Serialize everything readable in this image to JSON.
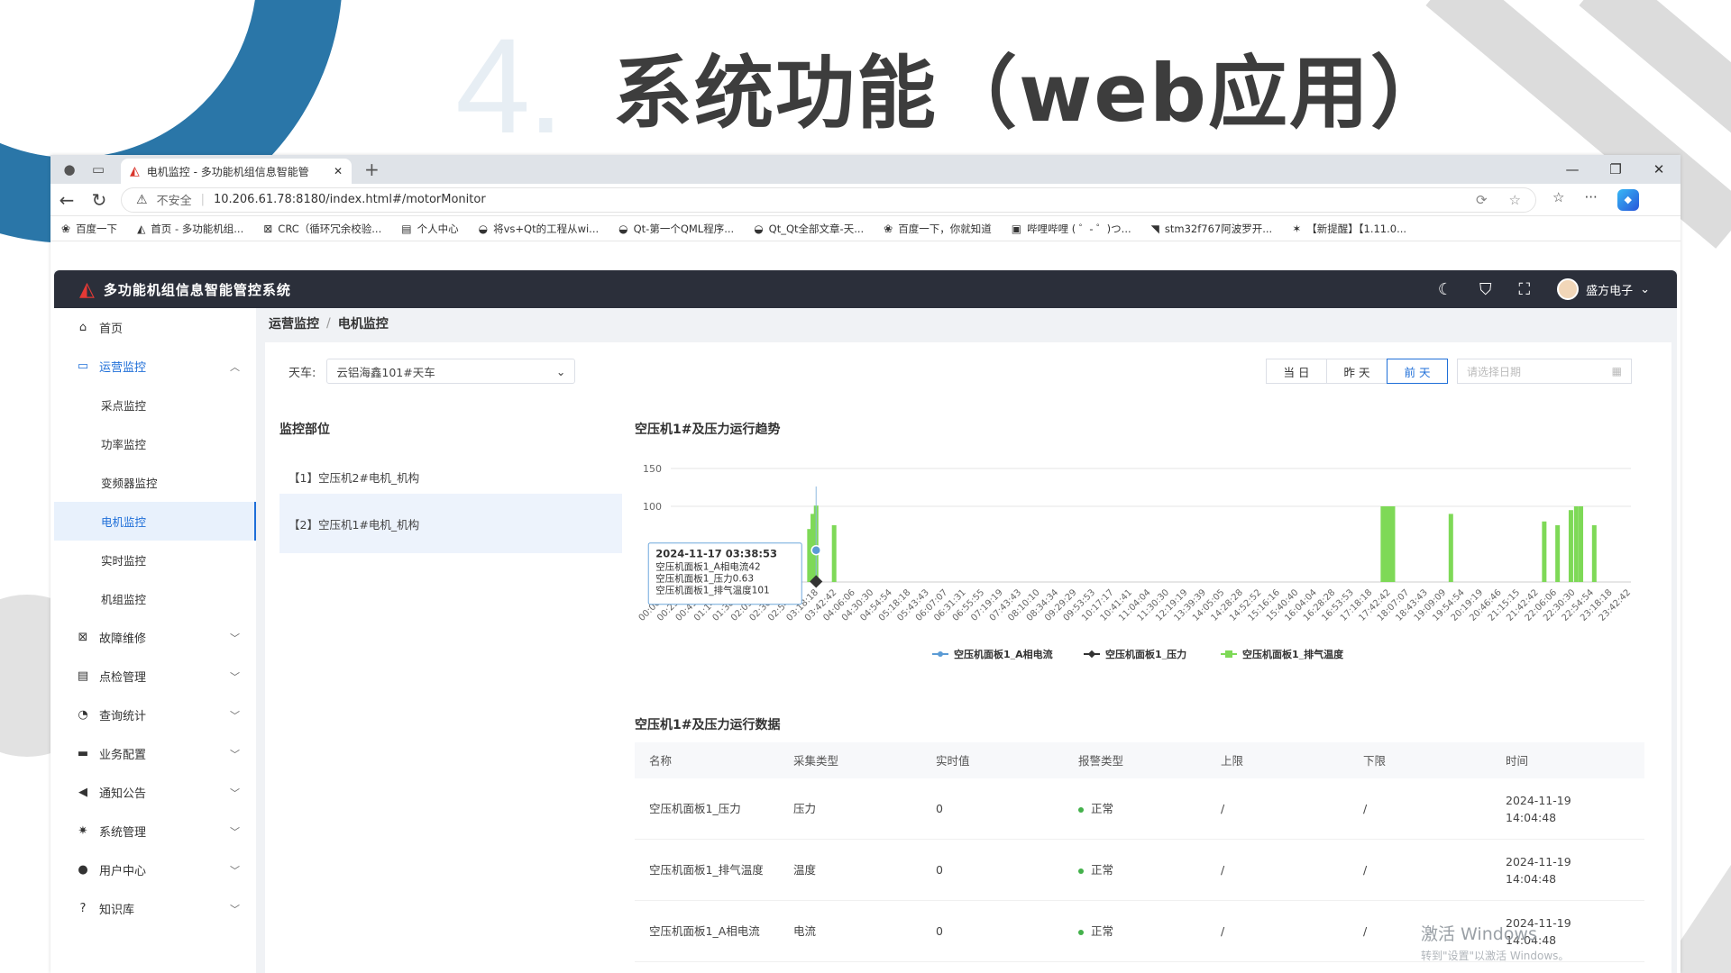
{
  "slide": {
    "number": "4",
    "title": "系统功能（web应用）"
  },
  "browser": {
    "tab_title": "电机监控 - 多功能机组信息智能管",
    "address_insecure": "不安全",
    "address_url": "10.206.61.78:8180/index.html#/motorMonitor",
    "bookmarks": [
      {
        "icon": "baidu-icon",
        "label": "百度一下"
      },
      {
        "icon": "app-logo-icon",
        "label": "首页 - 多功能机组..."
      },
      {
        "icon": "crc-icon",
        "label": "CRC（循环冗余校验..."
      },
      {
        "icon": "folder-icon",
        "label": "个人中心"
      },
      {
        "icon": "csdn-icon",
        "label": "将vs+Qt的工程从wi..."
      },
      {
        "icon": "csdn-icon",
        "label": "Qt-第一个QML程序..."
      },
      {
        "icon": "csdn-icon",
        "label": "Qt_Qt全部文章-天..."
      },
      {
        "icon": "baidu-icon",
        "label": "百度一下，你就知道"
      },
      {
        "icon": "bilibili-icon",
        "label": "哔哩哔哩 ( ゜- ゜)つ..."
      },
      {
        "icon": "link-icon",
        "label": "stm32f767阿波罗开..."
      },
      {
        "icon": "news-icon",
        "label": "【新提醒】【1.11.0..."
      }
    ]
  },
  "app": {
    "title": "多功能机组信息智能管控系统",
    "user": "盛方电子",
    "menu": [
      {
        "key": "home",
        "icon": "home-icon",
        "label": "首页",
        "chevron": false
      },
      {
        "key": "ops",
        "icon": "monitor-icon",
        "label": "运营监控",
        "chevron": true,
        "open": true
      },
      {
        "key": "fault",
        "icon": "wrench-icon",
        "label": "故障维修",
        "chevron": true
      },
      {
        "key": "inspect",
        "icon": "clipboard-icon",
        "label": "点检管理",
        "chevron": true
      },
      {
        "key": "stats",
        "icon": "pie-icon",
        "label": "查询统计",
        "chevron": true
      },
      {
        "key": "biz",
        "icon": "briefcase-icon",
        "label": "业务配置",
        "chevron": true
      },
      {
        "key": "notice",
        "icon": "speaker-icon",
        "label": "通知公告",
        "chevron": true
      },
      {
        "key": "sys",
        "icon": "gear-icon",
        "label": "系统管理",
        "chevron": true
      },
      {
        "key": "user",
        "icon": "user-icon",
        "label": "用户中心",
        "chevron": true
      },
      {
        "key": "kb",
        "icon": "question-icon",
        "label": "知识库",
        "chevron": true
      }
    ],
    "submenu": [
      "采点监控",
      "功率监控",
      "变频器监控",
      "电机监控",
      "实时监控",
      "机组监控"
    ],
    "active_submenu": 3,
    "breadcrumb": [
      "运营监控",
      "电机监控"
    ],
    "filter_label": "天车:",
    "filter_value": "云铝海鑫101#天车",
    "date_buttons": [
      "当 日",
      "昨 天",
      "前 天"
    ],
    "active_date_button": 2,
    "date_placeholder": "请选择日期",
    "monitor_title": "监控部位",
    "monitor_items": [
      "【1】空压机2#电机_机构",
      "【2】空压机1#电机_机构"
    ],
    "selected_monitor": 1,
    "chart_title": "空压机1#及压力运行趋势",
    "data_title": "空压机1#及压力运行数据",
    "table": {
      "headers": [
        "名称",
        "采集类型",
        "实时值",
        "报警类型",
        "上限",
        "下限",
        "时间"
      ],
      "rows": [
        {
          "name": "空压机面板1_压力",
          "type": "压力",
          "value": "0",
          "alarm": "正常",
          "upper": "/",
          "lower": "/",
          "date": "2024-11-19",
          "time": "14:04:48"
        },
        {
          "name": "空压机面板1_排气温度",
          "type": "温度",
          "value": "0",
          "alarm": "正常",
          "upper": "/",
          "lower": "/",
          "date": "2024-11-19",
          "time": "14:04:48"
        },
        {
          "name": "空压机面板1_A相电流",
          "type": "电流",
          "value": "0",
          "alarm": "正常",
          "upper": "/",
          "lower": "/",
          "date": "2024-11-19",
          "time": "14:04:48"
        }
      ]
    }
  },
  "chart_data": {
    "type": "bar",
    "ylim": [
      0,
      150
    ],
    "yticks": [
      100,
      150
    ],
    "x": [
      "00:00:00",
      "00:25:24",
      "00:49:48",
      "01:14:12",
      "01:38:36",
      "02:05:00",
      "02:30:30",
      "02:54:54",
      "03:18:18",
      "03:42:42",
      "04:06:06",
      "04:30:30",
      "04:54:54",
      "05:18:18",
      "05:43:43",
      "06:07:07",
      "06:31:31",
      "06:55:55",
      "07:19:19",
      "07:43:43",
      "08:10:10",
      "08:34:34",
      "09:29:29",
      "09:53:53",
      "10:17:17",
      "10:41:41",
      "11:04:04",
      "11:30:30",
      "12:19:19",
      "13:39:39",
      "14:05:05",
      "14:28:28",
      "14:52:52",
      "15:16:16",
      "15:40:40",
      "16:04:04",
      "16:28:28",
      "16:53:53",
      "17:18:18",
      "17:42:42",
      "18:07:07",
      "18:43:43",
      "19:09:09",
      "19:54:54",
      "20:19:19",
      "20:46:46",
      "21:15:15",
      "21:42:42",
      "22:06:06",
      "22:30:30",
      "22:54:54",
      "23:18:18",
      "23:42:42"
    ],
    "bars_temperature": [
      {
        "x": "03:13",
        "value": 45
      },
      {
        "x": "03:28",
        "value": 70
      },
      {
        "x": "03:33",
        "value": 90
      },
      {
        "x": "03:38",
        "value": 101
      },
      {
        "x": "04:05",
        "value": 75
      },
      {
        "x": "17:48",
        "value": 100
      },
      {
        "x": "17:54",
        "value": 100
      },
      {
        "x": "17:58",
        "value": 100
      },
      {
        "x": "18:03",
        "value": 100
      },
      {
        "x": "19:30",
        "value": 90
      },
      {
        "x": "21:50",
        "value": 80
      },
      {
        "x": "22:10",
        "value": 75
      },
      {
        "x": "22:30",
        "value": 95
      },
      {
        "x": "22:38",
        "value": 100
      },
      {
        "x": "22:45",
        "value": 100
      },
      {
        "x": "23:05",
        "value": 75
      }
    ],
    "tooltip": {
      "time": "2024-11-17 03:38:53",
      "lines": [
        "空压机面板1_A相电流42",
        "空压机面板1_压力0.63",
        "空压机面板1_排气温度101"
      ],
      "x": "03:38",
      "current": 42,
      "pressure": 0.63
    },
    "legend": [
      "空压机面板1_A相电流",
      "空压机面板1_压力",
      "空压机面板1_排气温度"
    ],
    "colors": {
      "current": "#5b9bd5",
      "pressure": "#333333",
      "temperature": "#7ed957"
    }
  },
  "watermark": {
    "line1": "激活 Windows",
    "line2": "转到\"设置\"以激活 Windows。"
  }
}
